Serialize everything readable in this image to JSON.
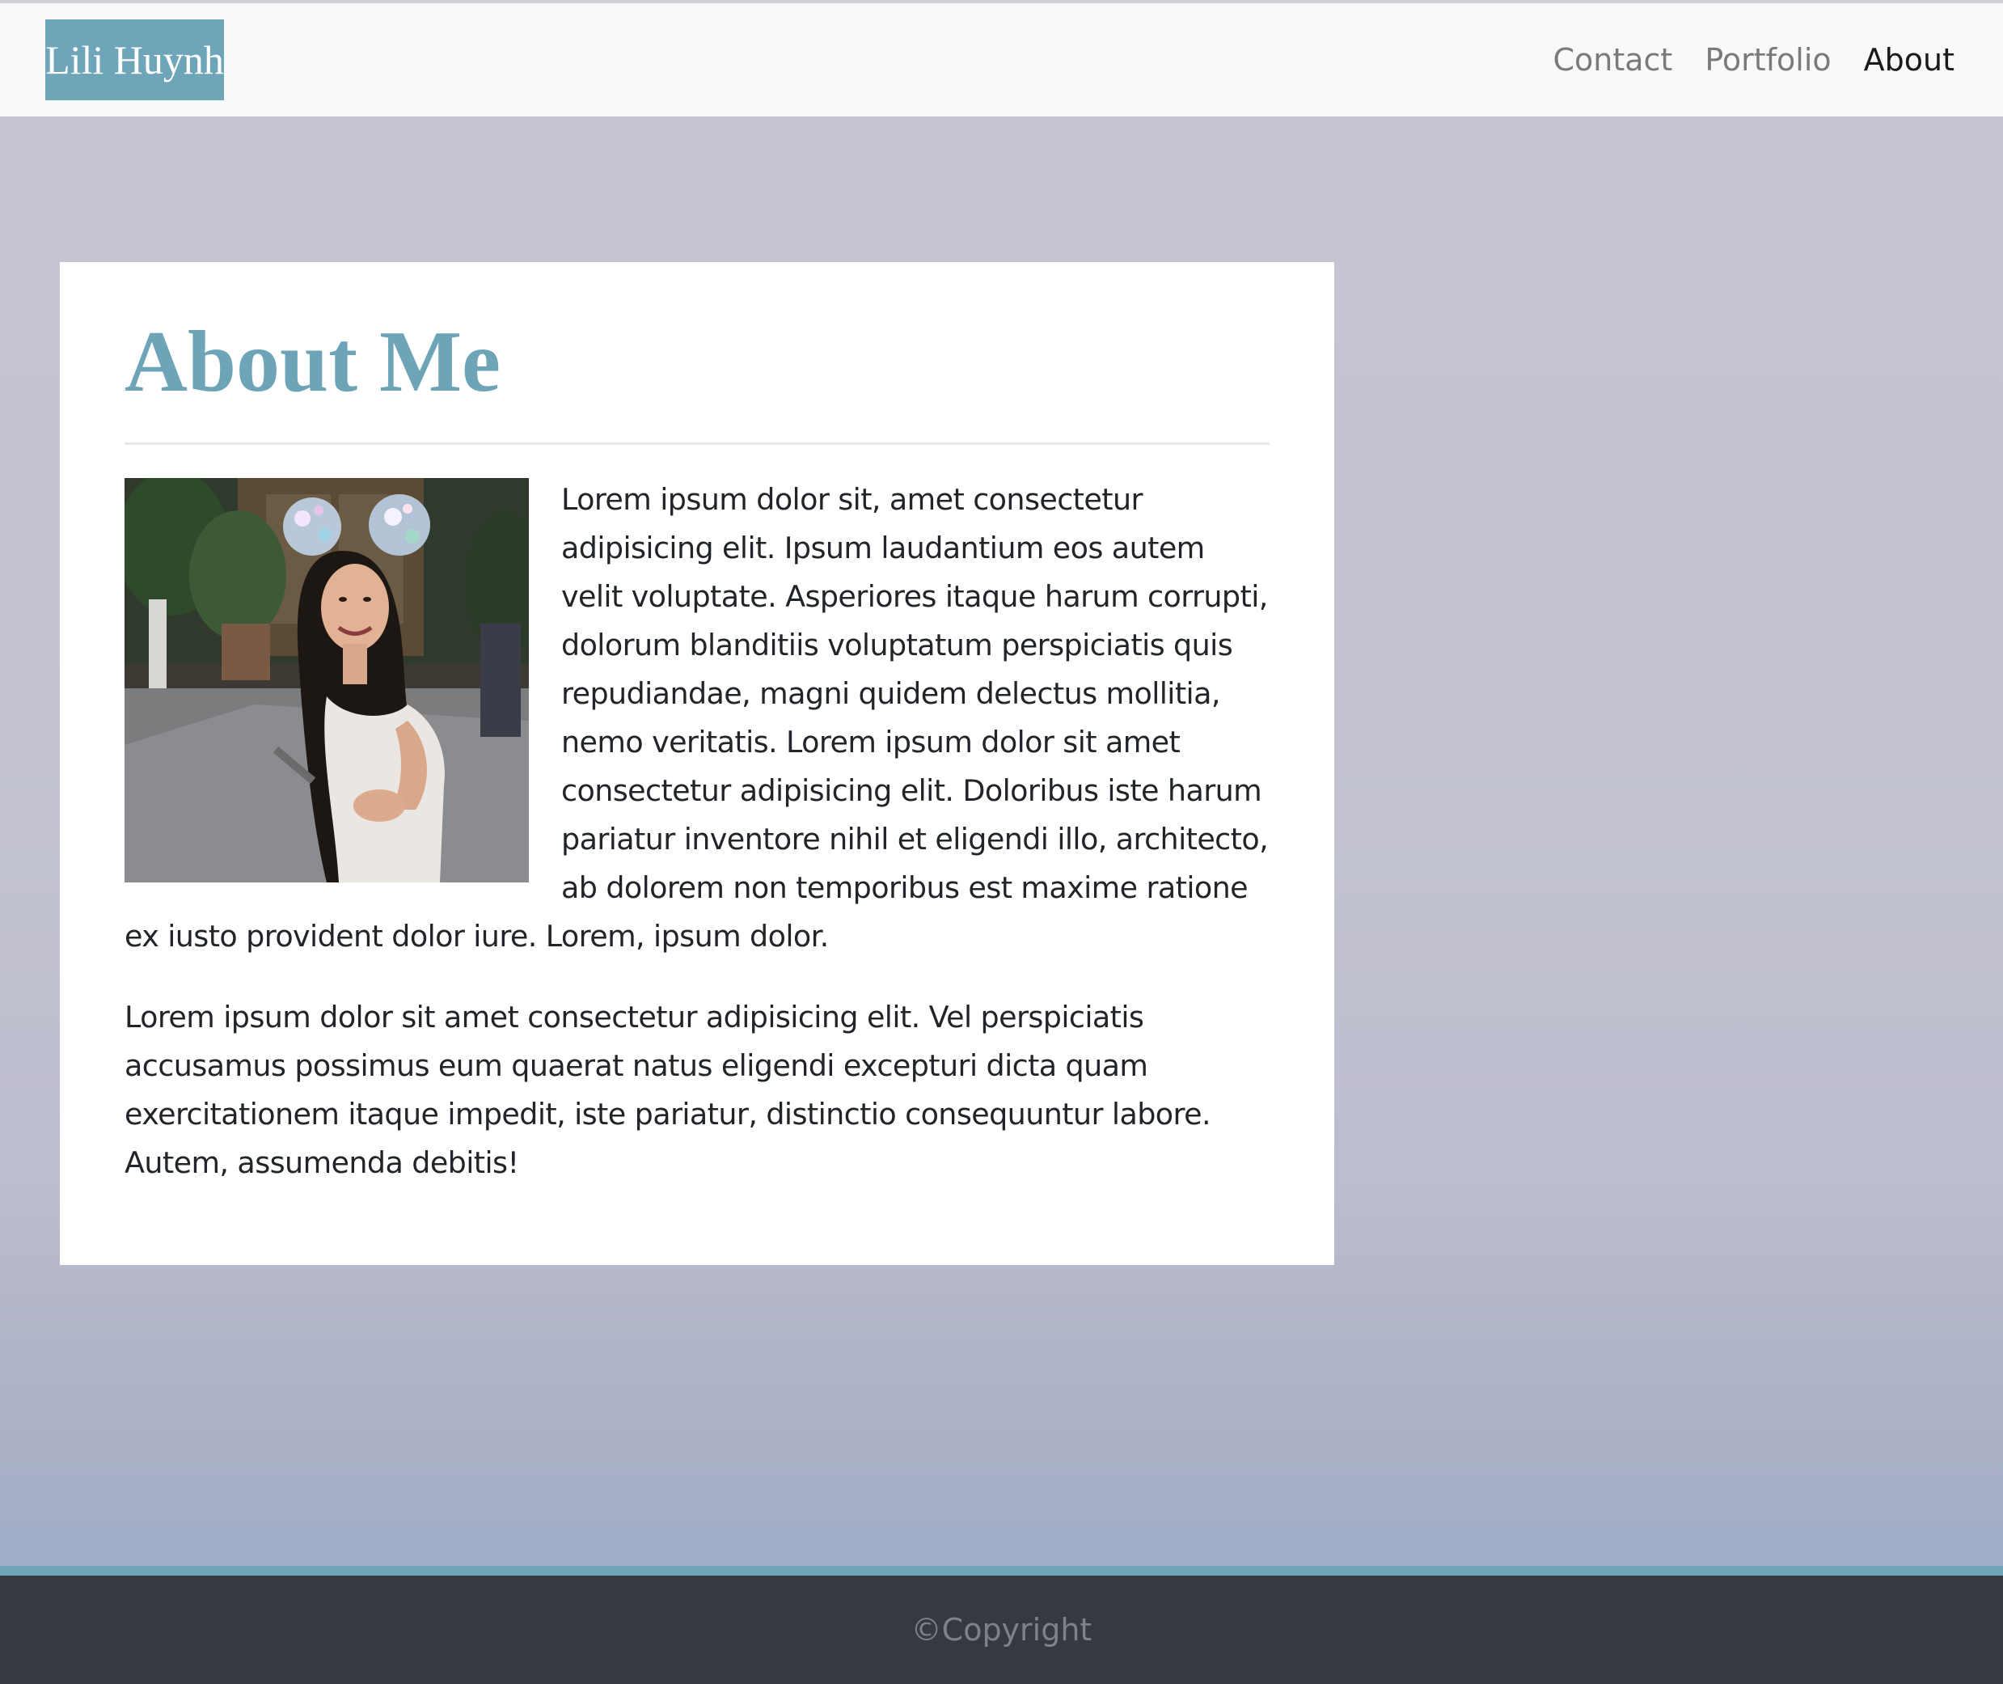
{
  "navbar": {
    "brand": "Lili Huynh",
    "links": [
      {
        "label": "Contact"
      },
      {
        "label": "Portfolio"
      },
      {
        "label": "About",
        "active": true
      }
    ]
  },
  "about": {
    "title": "About Me",
    "photo_alt": "Photo of Lili Huynh wearing sparkly ear headband",
    "paragraph1": "Lorem ipsum dolor sit, amet consectetur adipisicing elit. Ipsum laudantium eos autem velit voluptate. Asperiores itaque harum corrupti, dolorum blanditiis voluptatum perspiciatis quis repudiandae, magni quidem delectus mollitia, nemo veritatis. Lorem ipsum dolor sit amet consectetur adipisicing elit. Doloribus iste harum pariatur inventore nihil et eligendi illo, architecto, ab dolorem non temporibus est maxime ratione ex iusto provident dolor iure. Lorem, ipsum dolor.",
    "paragraph2": "Lorem ipsum dolor sit amet consectetur adipisicing elit. Vel perspiciatis accusamus possimus eum quaerat natus eligendi excepturi dicta quam exercitationem itaque impedit, iste pariatur, distinctio consequuntur labore. Autem, assumenda debitis!"
  },
  "footer": {
    "text": "©Copyright"
  },
  "colors": {
    "accent": "#6fa5b9",
    "footer_bg": "#343a40",
    "navbar_bg": "#f8f9fa"
  }
}
